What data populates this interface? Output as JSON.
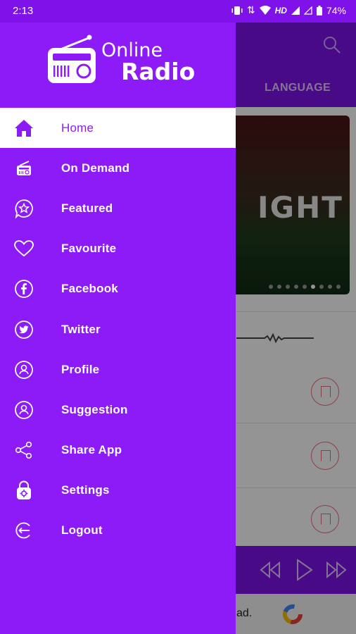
{
  "status_bar": {
    "time": "2:13",
    "network": "HD",
    "battery": "74%"
  },
  "app": {
    "logo_line1": "Online",
    "logo_line2": "Radio",
    "background_tab": "LANGUAGE",
    "banner_text": "IGHT",
    "ad_text": "ad."
  },
  "drawer": {
    "items": [
      {
        "label": "Home",
        "icon": "home-icon",
        "active": true
      },
      {
        "label": "On Demand",
        "icon": "radio-icon"
      },
      {
        "label": "Featured",
        "icon": "featured-star-icon"
      },
      {
        "label": "Favourite",
        "icon": "heart-icon"
      },
      {
        "label": "Facebook",
        "icon": "facebook-icon"
      },
      {
        "label": "Twitter",
        "icon": "twitter-icon"
      },
      {
        "label": "Profile",
        "icon": "profile-icon"
      },
      {
        "label": "Suggestion",
        "icon": "suggestion-icon"
      },
      {
        "label": "Share App",
        "icon": "share-icon"
      },
      {
        "label": "Settings",
        "icon": "settings-lock-icon"
      },
      {
        "label": "Logout",
        "icon": "logout-icon"
      }
    ]
  },
  "colors": {
    "primary": "#8d1bf8",
    "appbar": "#7e12e8",
    "accent_bookmark": "#ef6a7b"
  }
}
